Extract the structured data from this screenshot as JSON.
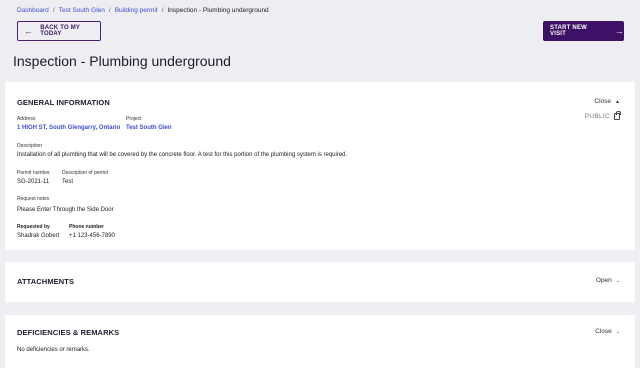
{
  "breadcrumb": {
    "items": [
      "Dashboard",
      "Test South Glen",
      "Building permit"
    ],
    "separator": "/",
    "current": "Inspection - Plumbing underground"
  },
  "actions": {
    "back_label": "BACK TO MY TODAY",
    "start_label": "START NEW VISIT"
  },
  "page": {
    "title": "Inspection - Plumbing underground"
  },
  "general": {
    "title": "GENERAL INFORMATION",
    "toggle_label": "Close",
    "address_label": "Address",
    "address_value": "1 HIGH ST, South Glengarry, Ontario",
    "project_label": "Project",
    "project_value": "Test South Glen",
    "description_label": "Description",
    "description_value": "Installation of all plumbing that will be covered by the concrete floor. A test for this portion of the plumbing system is required.",
    "permit_number_label": "Permit number",
    "permit_number_value": "SG-2021-11",
    "permit_desc_label": "Description of permit",
    "permit_desc_value": "Test",
    "request_notes_label": "Request notes",
    "request_notes_value": "Please Enter Through the Side Door",
    "visibility_label": "PUBLIC",
    "requested_by_label": "Requested by",
    "requested_by_value": "Shadrak Gobert",
    "phone_label": "Phone number",
    "phone_value": "+1 123-456-7890"
  },
  "attachments": {
    "title": "ATTACHMENTS",
    "toggle_label": "Open"
  },
  "deficiencies": {
    "title": "DEFICIENCIES & REMARKS",
    "toggle_label": "Close",
    "empty_text": "No deficiencies or remarks."
  },
  "colors": {
    "accent": "#3d1166",
    "link": "#3b4fd0",
    "background": "#eeedf1"
  }
}
